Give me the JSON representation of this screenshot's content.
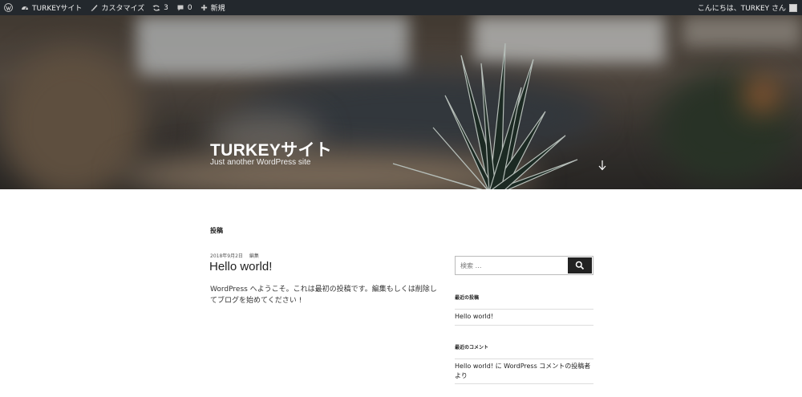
{
  "adminbar": {
    "site_name": "TURKEYサイト",
    "customize": "カスタマイズ",
    "updates_count": "3",
    "comments_count": "0",
    "new_label": "新規",
    "greeting": "こんにちは、TURKEY さん"
  },
  "header": {
    "site_title": "TURKEYサイト",
    "site_description": "Just another WordPress site"
  },
  "main": {
    "page_heading": "投稿",
    "post": {
      "date": "2018年9月2日",
      "edit_label": "編集",
      "title": "Hello world!",
      "body": "WordPress へようこそ。これは最初の投稿です。編集もしくは削除してブログを始めてください !"
    }
  },
  "sidebar": {
    "search_placeholder": "検索 …",
    "recent_posts_title": "最近の投稿",
    "recent_posts": [
      "Hello world!"
    ],
    "recent_comments_title": "最近のコメント",
    "recent_comments": [
      "Hello world! に WordPress コメントの投稿者 より"
    ]
  },
  "icons": {
    "wp_logo": "wordpress-icon",
    "site": "dashboard-icon",
    "customize": "brush-icon",
    "updates": "updates-icon",
    "comments": "comment-icon",
    "new": "plus-icon",
    "scroll": "arrow-down-icon",
    "search": "search-icon"
  }
}
